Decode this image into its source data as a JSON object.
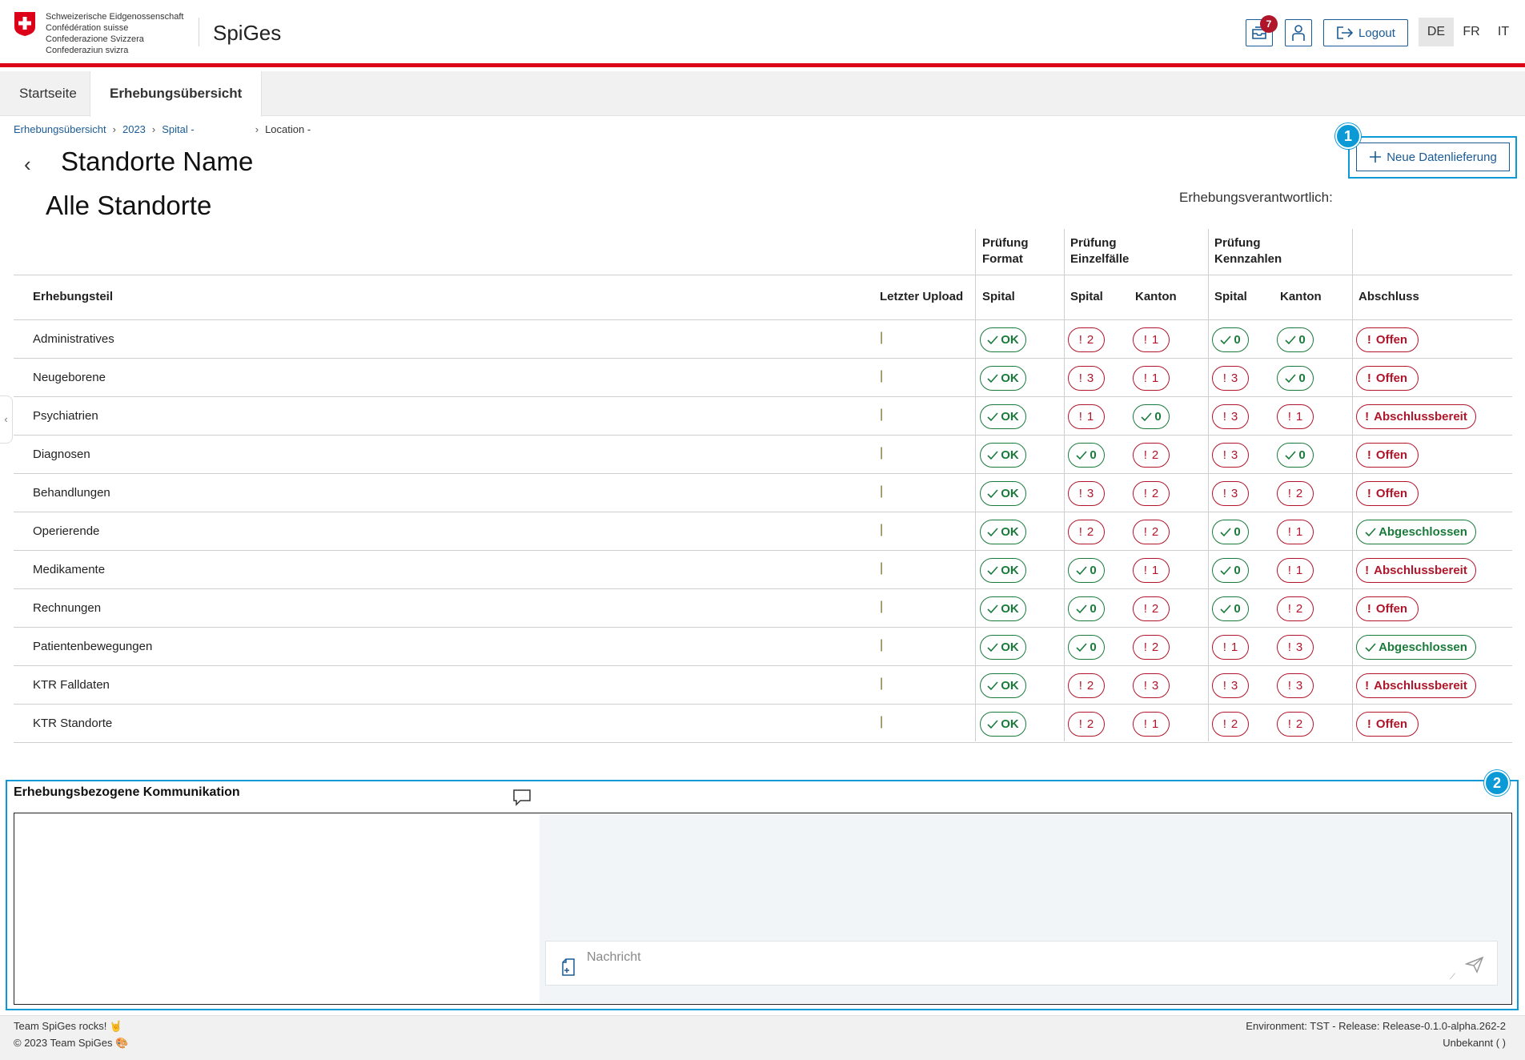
{
  "header": {
    "logo_lines": [
      "Schweizerische Eidgenossenschaft",
      "Confédération suisse",
      "Confederazione Svizzera",
      "Confederaziun svizra"
    ],
    "app_title": "SpiGes",
    "notification_count": "7",
    "logout_label": "Logout",
    "languages": [
      "DE",
      "FR",
      "IT"
    ],
    "active_language": "DE"
  },
  "tabs": [
    {
      "label": "Startseite"
    },
    {
      "label": "Erhebungsübersicht"
    }
  ],
  "breadcrumb": [
    "Erhebungsübersicht",
    "2023",
    "Spital -",
    "Location -"
  ],
  "page": {
    "title": "Standorte Name",
    "subtitle": "Alle Standorte",
    "verantwortlich_label": "Erhebungsverantwortlich:",
    "new_button_label": "Neue Datenlieferung",
    "callout_1": "1",
    "callout_2": "2"
  },
  "table": {
    "group_headers": {
      "format": [
        "Prüfung",
        "Format"
      ],
      "einzelfaelle": [
        "Prüfung",
        "Einzelfälle"
      ],
      "kennzahlen": [
        "Prüfung",
        "Kennzahlen"
      ]
    },
    "columns": {
      "erhebungsteil": "Erhebungsteil",
      "letzter_upload": "Letzter Upload",
      "format_spital": "Spital",
      "einzel_spital": "Spital",
      "einzel_kanton": "Kanton",
      "kenn_spital": "Spital",
      "kenn_kanton": "Kanton",
      "abschluss": "Abschluss"
    },
    "upload_marker": "|",
    "rows": [
      {
        "name": "Administratives",
        "format": "OK",
        "es": "2",
        "es_ok": false,
        "ek": "1",
        "ek_ok": false,
        "ks": "0",
        "ks_ok": true,
        "kk": "0",
        "kk_ok": true,
        "abschluss": "Offen",
        "abschluss_ok": false
      },
      {
        "name": "Neugeborene",
        "format": "OK",
        "es": "3",
        "es_ok": false,
        "ek": "1",
        "ek_ok": false,
        "ks": "3",
        "ks_ok": false,
        "kk": "0",
        "kk_ok": true,
        "abschluss": "Offen",
        "abschluss_ok": false
      },
      {
        "name": "Psychiatrien",
        "format": "OK",
        "es": "1",
        "es_ok": false,
        "ek": "0",
        "ek_ok": true,
        "ks": "3",
        "ks_ok": false,
        "kk": "1",
        "kk_ok": false,
        "abschluss": "Abschlussbereit",
        "abschluss_ok": false
      },
      {
        "name": "Diagnosen",
        "format": "OK",
        "es": "0",
        "es_ok": true,
        "ek": "2",
        "ek_ok": false,
        "ks": "3",
        "ks_ok": false,
        "kk": "0",
        "kk_ok": true,
        "abschluss": "Offen",
        "abschluss_ok": false
      },
      {
        "name": "Behandlungen",
        "format": "OK",
        "es": "3",
        "es_ok": false,
        "ek": "2",
        "ek_ok": false,
        "ks": "3",
        "ks_ok": false,
        "kk": "2",
        "kk_ok": false,
        "abschluss": "Offen",
        "abschluss_ok": false
      },
      {
        "name": "Operierende",
        "format": "OK",
        "es": "2",
        "es_ok": false,
        "ek": "2",
        "ek_ok": false,
        "ks": "0",
        "ks_ok": true,
        "kk": "1",
        "kk_ok": false,
        "abschluss": "Abgeschlossen",
        "abschluss_ok": true
      },
      {
        "name": "Medikamente",
        "format": "OK",
        "es": "0",
        "es_ok": true,
        "ek": "1",
        "ek_ok": false,
        "ks": "0",
        "ks_ok": true,
        "kk": "1",
        "kk_ok": false,
        "abschluss": "Abschlussbereit",
        "abschluss_ok": false
      },
      {
        "name": "Rechnungen",
        "format": "OK",
        "es": "0",
        "es_ok": true,
        "ek": "2",
        "ek_ok": false,
        "ks": "0",
        "ks_ok": true,
        "kk": "2",
        "kk_ok": false,
        "abschluss": "Offen",
        "abschluss_ok": false
      },
      {
        "name": "Patientenbewegungen",
        "format": "OK",
        "es": "0",
        "es_ok": true,
        "ek": "2",
        "ek_ok": false,
        "ks": "1",
        "ks_ok": false,
        "kk": "3",
        "kk_ok": false,
        "abschluss": "Abgeschlossen",
        "abschluss_ok": true
      },
      {
        "name": "KTR Falldaten",
        "format": "OK",
        "es": "2",
        "es_ok": false,
        "ek": "3",
        "ek_ok": false,
        "ks": "3",
        "ks_ok": false,
        "kk": "3",
        "kk_ok": false,
        "abschluss": "Abschlussbereit",
        "abschluss_ok": false
      },
      {
        "name": "KTR Standorte",
        "format": "OK",
        "es": "2",
        "es_ok": false,
        "ek": "1",
        "ek_ok": false,
        "ks": "2",
        "ks_ok": false,
        "kk": "2",
        "kk_ok": false,
        "abschluss": "Offen",
        "abschluss_ok": false
      }
    ]
  },
  "communication": {
    "title": "Erhebungsbezogene Kommunikation",
    "message_placeholder": "Nachricht"
  },
  "footer": {
    "left_1": "Team SpiGes rocks! 🤘",
    "left_2": "© 2023 Team SpiGes 🎨",
    "right_1": "Environment: TST - Release: Release-0.1.0-alpha.262-2",
    "right_2": "Unbekannt (           )"
  },
  "colors": {
    "brand_red": "#dc0018",
    "primary_blue": "#1a5b95",
    "ok_green": "#1a7a3a",
    "error_red": "#b0152a",
    "callout_blue": "#0c9ad6"
  }
}
